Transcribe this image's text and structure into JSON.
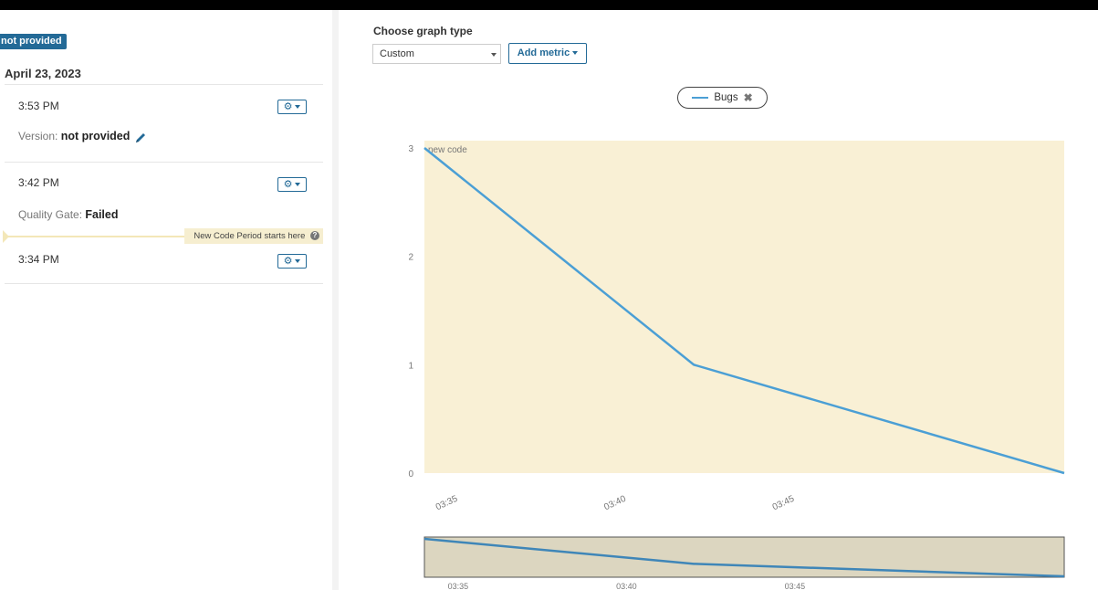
{
  "sidebar": {
    "version_badge": "not provided",
    "date": "April 23, 2023",
    "events": [
      {
        "time": "3:53 PM",
        "detail_label": "Version:",
        "detail_value": "not provided"
      },
      {
        "time": "3:42 PM",
        "detail_label": "Quality Gate:",
        "detail_value": "Failed"
      },
      {
        "time": "3:34 PM"
      }
    ],
    "new_code_period_label": "New Code Period starts here",
    "help_glyph": "?",
    "gear_glyph": "⚙"
  },
  "graph_controls": {
    "label": "Choose graph type",
    "selected": "Custom",
    "add_metric_label": "Add metric"
  },
  "legend": {
    "metric": "Bugs",
    "close_glyph": "✖"
  },
  "colors": {
    "accent": "#236a97",
    "series": "#4b9fd5",
    "new_code_background": "#f9f0d5",
    "overview_fill": "#dcd6c0"
  },
  "chart_data": {
    "type": "line",
    "annotation": "new code",
    "x_tick_labels": [
      "03:35",
      "03:40",
      "03:45"
    ],
    "y_tick_labels": [
      "0",
      "1",
      "2",
      "3"
    ],
    "ylim": [
      0,
      3
    ],
    "xlim_minutes": [
      34,
      53
    ],
    "series": [
      {
        "name": "Bugs",
        "x_minutes": [
          34,
          42,
          53
        ],
        "values": [
          3,
          1,
          0
        ]
      }
    ],
    "overview_tick_labels": [
      "03:35",
      "03:40",
      "03:45"
    ]
  }
}
